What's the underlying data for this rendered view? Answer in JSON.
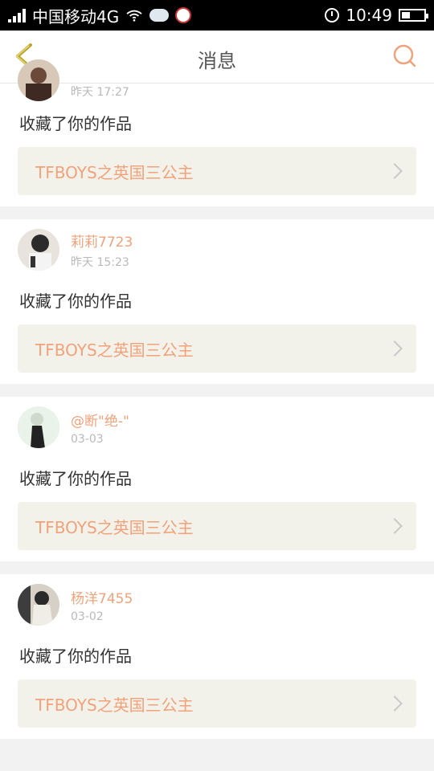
{
  "status_bar": {
    "carrier": "中国移动4G",
    "time": "10:49"
  },
  "header": {
    "title": "消息"
  },
  "messages": [
    {
      "name": "",
      "time": "昨天 17:27",
      "action": "收藏了你的作品",
      "work_title": "TFBOYS之英国三公主"
    },
    {
      "name": "莉莉7723",
      "time": "昨天 15:23",
      "action": "收藏了你的作品",
      "work_title": "TFBOYS之英国三公主"
    },
    {
      "name": "@断\"绝-\"",
      "time": "03-03",
      "action": "收藏了你的作品",
      "work_title": "TFBOYS之英国三公主"
    },
    {
      "name": "杨洋7455",
      "time": "03-02",
      "action": "收藏了你的作品",
      "work_title": "TFBOYS之英国三公主"
    }
  ],
  "colors": {
    "accent": "#f0a27a",
    "back_icon": "#b9a32a",
    "panel": "#f3f2ea"
  }
}
